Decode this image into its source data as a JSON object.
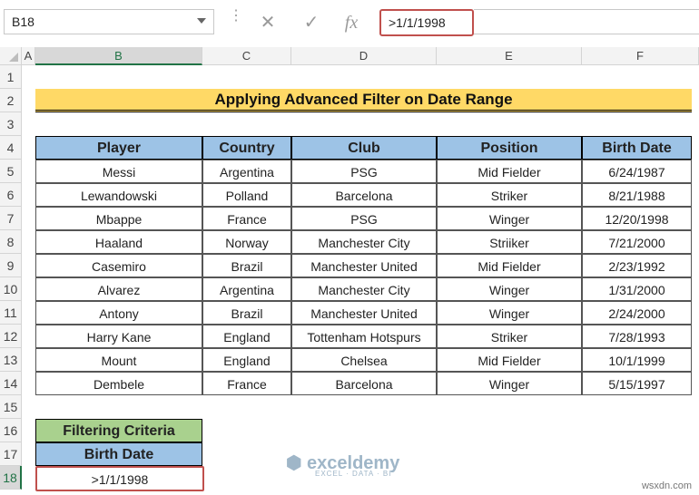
{
  "formula_bar": {
    "name_box": "B18",
    "formula": ">1/1/1998",
    "cancel_icon": "✕",
    "enter_icon": "✓",
    "fx_label": "fx"
  },
  "columns": [
    "A",
    "B",
    "C",
    "D",
    "E",
    "F"
  ],
  "rows": [
    "1",
    "2",
    "3",
    "4",
    "5",
    "6",
    "7",
    "8",
    "9",
    "10",
    "11",
    "12",
    "13",
    "14",
    "15",
    "16",
    "17",
    "18"
  ],
  "title": "Applying Advanced Filter on Date Range",
  "table": {
    "headers": [
      "Player",
      "Country",
      "Club",
      "Position",
      "Birth Date"
    ],
    "rows": [
      [
        "Messi",
        "Argentina",
        "PSG",
        "Mid Fielder",
        "6/24/1987"
      ],
      [
        "Lewandowski",
        "Polland",
        "Barcelona",
        "Striker",
        "8/21/1988"
      ],
      [
        "Mbappe",
        "France",
        "PSG",
        "Winger",
        "12/20/1998"
      ],
      [
        "Haaland",
        "Norway",
        "Manchester City",
        "Striiker",
        "7/21/2000"
      ],
      [
        "Casemiro",
        "Brazil",
        "Manchester United",
        "Mid Fielder",
        "2/23/1992"
      ],
      [
        "Alvarez",
        "Argentina",
        "Manchester City",
        "Winger",
        "1/31/2000"
      ],
      [
        "Antony",
        "Brazil",
        "Manchester United",
        "Winger",
        "2/24/2000"
      ],
      [
        "Harry Kane",
        "England",
        "Tottenham Hotspurs",
        "Striker",
        "7/28/1993"
      ],
      [
        "Mount",
        "England",
        "Chelsea",
        "Mid Fielder",
        "10/1/1999"
      ],
      [
        "Dembele",
        "France",
        "Barcelona",
        "Winger",
        "5/15/1997"
      ]
    ]
  },
  "criteria": {
    "title": "Filtering Criteria",
    "header": "Birth Date",
    "value": ">1/1/1998"
  },
  "watermark": {
    "brand": "exceldemy",
    "tagline": "EXCEL · DATA · BI"
  },
  "site_credit": "wsxdn.com"
}
